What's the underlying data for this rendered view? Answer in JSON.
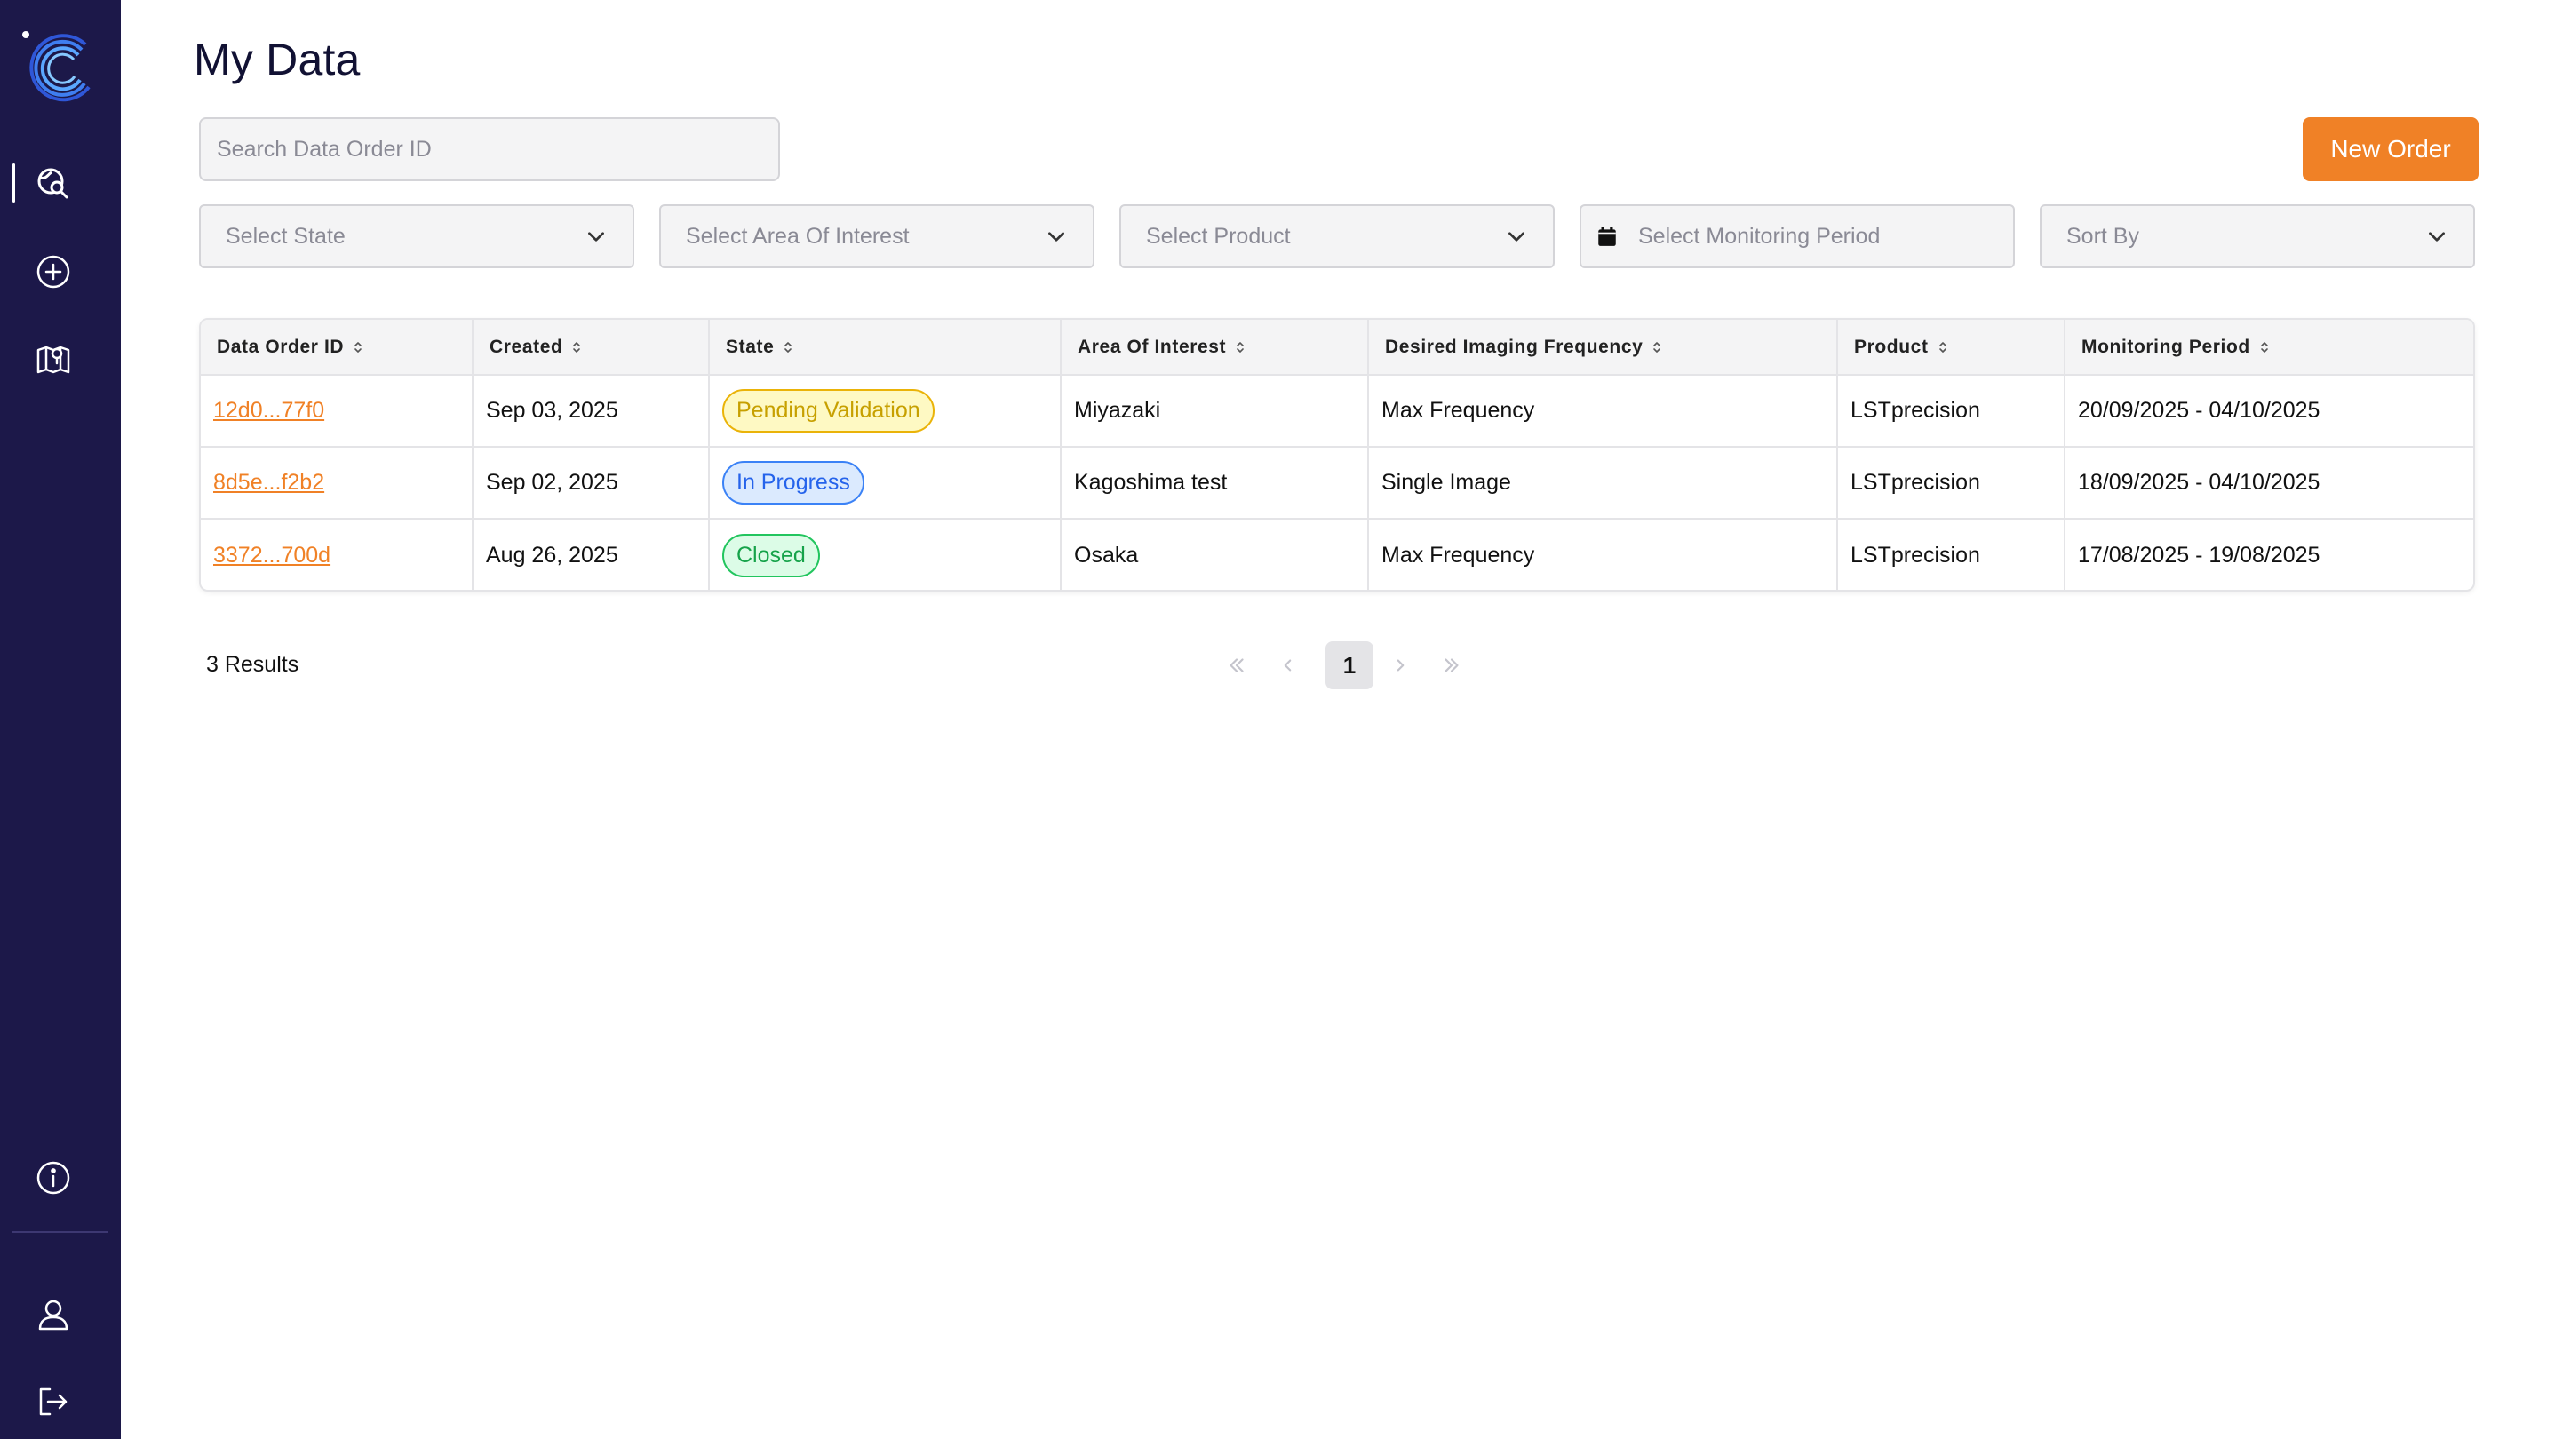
{
  "page": {
    "title": "My Data"
  },
  "toolbar": {
    "search_placeholder": "Search Data Order ID",
    "new_order_label": "New Order"
  },
  "filters": {
    "state": "Select State",
    "area": "Select Area Of Interest",
    "product": "Select Product",
    "period": "Select Monitoring Period",
    "sort": "Sort By"
  },
  "table": {
    "headers": [
      "Data Order ID",
      "Created",
      "State",
      "Area Of Interest",
      "Desired Imaging Frequency",
      "Product",
      "Monitoring Period"
    ],
    "rows": [
      {
        "id": "12d0...77f0",
        "created": "Sep 03, 2025",
        "state": "Pending Validation",
        "state_kind": "pending",
        "area": "Miyazaki",
        "frequency": "Max Frequency",
        "product": "LSTprecision",
        "period": "20/09/2025 - 04/10/2025"
      },
      {
        "id": "8d5e...f2b2",
        "created": "Sep 02, 2025",
        "state": "In Progress",
        "state_kind": "progress",
        "area": "Kagoshima test",
        "frequency": "Single Image",
        "product": "LSTprecision",
        "period": "18/09/2025 - 04/10/2025"
      },
      {
        "id": "3372...700d",
        "created": "Aug 26, 2025",
        "state": "Closed",
        "state_kind": "closed",
        "area": "Osaka",
        "frequency": "Max Frequency",
        "product": "LSTprecision",
        "period": "17/08/2025 - 19/08/2025"
      }
    ]
  },
  "footer": {
    "results": "3 Results",
    "current_page": "1"
  },
  "colors": {
    "sidebar": "#1c1849",
    "accent": "#f08126",
    "pending": "#eab308",
    "progress": "#3b82f6",
    "closed": "#22c55e"
  },
  "icons": {
    "sidebar": [
      "globe-search-icon",
      "plus-circle-icon",
      "map-pin-icon",
      "info-icon",
      "user-icon",
      "logout-icon"
    ]
  }
}
